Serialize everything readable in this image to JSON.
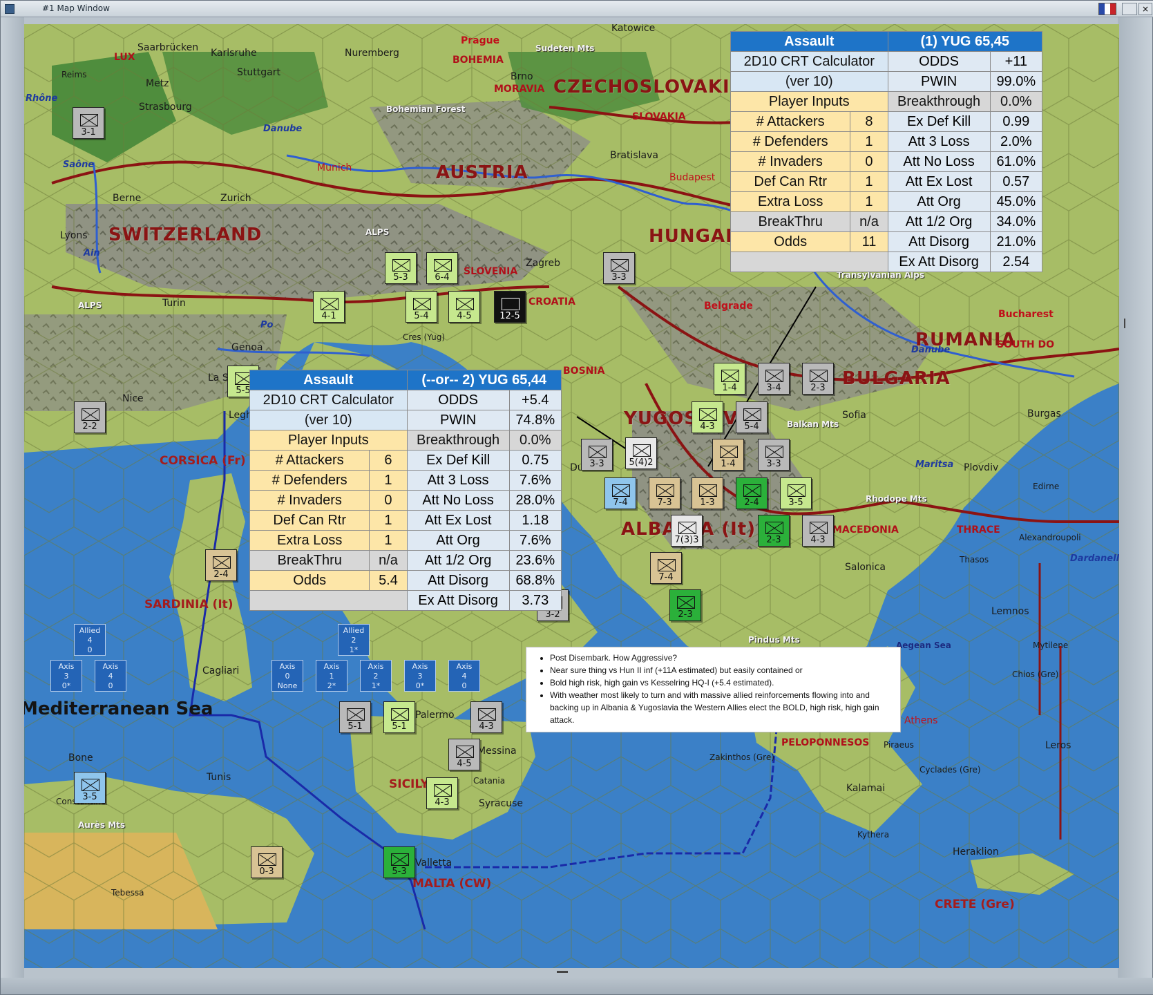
{
  "window": {
    "title": "#1 Map Window"
  },
  "calc1": {
    "header_left": "Assault",
    "header_right": "(1) YUG 65,45",
    "title_line1": "2D10 CRT Calculator",
    "title_line2": "(ver 10)",
    "inputs_label": "Player Inputs",
    "rows": [
      {
        "k": "# Attackers",
        "v": "8"
      },
      {
        "k": "# Defenders",
        "v": "1"
      },
      {
        "k": "# Invaders",
        "v": "0"
      },
      {
        "k": "Def Can Rtr",
        "v": "1"
      },
      {
        "k": "Extra Loss",
        "v": "1"
      },
      {
        "k": "BreakThru",
        "v": "n/a"
      },
      {
        "k": "Odds",
        "v": "11"
      }
    ],
    "results": [
      {
        "k": "ODDS",
        "v": "+11"
      },
      {
        "k": "PWIN",
        "v": "99.0%"
      },
      {
        "k": "Breakthrough",
        "v": "0.0%"
      },
      {
        "k": "Ex Def Kill",
        "v": "0.99"
      },
      {
        "k": "Att 3 Loss",
        "v": "2.0%"
      },
      {
        "k": "Att No Loss",
        "v": "61.0%"
      },
      {
        "k": "Att Ex Lost",
        "v": "0.57"
      },
      {
        "k": "Att Org",
        "v": "45.0%"
      },
      {
        "k": "Att 1/2 Org",
        "v": "34.0%"
      },
      {
        "k": "Att Disorg",
        "v": "21.0%"
      },
      {
        "k": "Ex Att Disorg",
        "v": "2.54"
      }
    ]
  },
  "calc2": {
    "header_left": "Assault",
    "header_right": "(--or-- 2) YUG 65,44",
    "title_line1": "2D10 CRT Calculator",
    "title_line2": "(ver 10)",
    "inputs_label": "Player Inputs",
    "rows": [
      {
        "k": "# Attackers",
        "v": "6"
      },
      {
        "k": "# Defenders",
        "v": "1"
      },
      {
        "k": "# Invaders",
        "v": "0"
      },
      {
        "k": "Def Can Rtr",
        "v": "1"
      },
      {
        "k": "Extra Loss",
        "v": "1"
      },
      {
        "k": "BreakThru",
        "v": "n/a"
      },
      {
        "k": "Odds",
        "v": "5.4"
      }
    ],
    "results": [
      {
        "k": "ODDS",
        "v": "+5.4"
      },
      {
        "k": "PWIN",
        "v": "74.8%"
      },
      {
        "k": "Breakthrough",
        "v": "0.0%"
      },
      {
        "k": "Ex Def Kill",
        "v": "0.75"
      },
      {
        "k": "Att 3 Loss",
        "v": "7.6%"
      },
      {
        "k": "Att No Loss",
        "v": "28.0%"
      },
      {
        "k": "Att Ex Lost",
        "v": "1.18"
      },
      {
        "k": "Att Org",
        "v": "7.6%"
      },
      {
        "k": "Att 1/2 Org",
        "v": "23.6%"
      },
      {
        "k": "Att Disorg",
        "v": "68.8%"
      },
      {
        "k": "Ex Att Disorg",
        "v": "3.73"
      }
    ]
  },
  "notes": [
    "Post Disembark.  How Aggressive?",
    "Near sure thing vs Hun II inf (+11A estimated) but easily contained or",
    "Bold high risk, high gain vs Kesselring HQ-I (+5.4 estimated).",
    "With weather most likely to turn and with massive allied reinforcements flowing into and backing up in Albania & Yugoslavia the Western Allies elect the BOLD, high risk, high gain attack."
  ],
  "map_labels": {
    "countries": [
      "SWITZERLAND",
      "AUSTRIA",
      "CZECHOSLOVAKIA",
      "HUNGARY",
      "YUGOSLAVIA",
      "BULGARIA",
      "RUMANIA",
      "ALBANIA (It)"
    ],
    "regions": [
      "CORSICA (Fr)",
      "SARDINIA (It)",
      "SICILY",
      "MALTA (CW)",
      "SLOVAKIA",
      "MORAVIA",
      "PELOPONNESOS",
      "CRETE (Gre)",
      "SOUTH DO",
      "THRACE",
      "MACEDONIA",
      "CROATIA",
      "SLOVENIA",
      "BOSNIA",
      "BOHEMIA",
      "LUX"
    ],
    "cities": [
      "Saarbrücken",
      "Karlsruhe",
      "Nuremberg",
      "Prague",
      "Katowice",
      "Reims",
      "Metz",
      "Stuttgart",
      "Brno",
      "Strasbourg",
      "Bohemian Forest",
      "Munich",
      "Bratislava",
      "Berne",
      "Zurich",
      "Budapest",
      "Lyons",
      "Zagreb",
      "Turin",
      "Belgrade",
      "Bucharest",
      "Nice",
      "Genoa",
      "La Spezia",
      "Cres (Yug)",
      "Sofia",
      "Burgas",
      "Plovdiv",
      "Edirne",
      "Salonica",
      "Alexandroupoli",
      "Thasos",
      "Lemnos",
      "Mytilene",
      "Chios (Gre)",
      "Athens",
      "Piraeus",
      "Leros",
      "Cyclades (Gre)",
      "Kalamai",
      "Kythera",
      "Heraklion",
      "Zakinthos (Gre)",
      "Pindus Mts",
      "Bone",
      "Tunis",
      "Constantine",
      "Aurès Mts",
      "Tebessa",
      "Catania",
      "Syracuse",
      "Messina",
      "Palermo",
      "Valletta",
      "Cagliari",
      "Legh",
      "Durazzo",
      "Sudeten Mts",
      "Transylvanian Alps",
      "Balkan Mts",
      "Rhodope Mts",
      "Aegean Sea",
      "Dardanelles"
    ],
    "rivers": [
      "Danube",
      "Saône",
      "Rhône",
      "Ain",
      "Po",
      "Maritsa",
      "Danube"
    ],
    "mountains": [
      "ALPS",
      "ALPS"
    ],
    "sea": "Mediterranean Sea"
  },
  "stack_boxes": [
    {
      "line1": "Allied",
      "line2": "4",
      "line3": "0"
    },
    {
      "line1": "Allied",
      "line2": "2",
      "line3": "1*"
    },
    {
      "line1": "Axis",
      "line2": "3",
      "line3": "0*"
    },
    {
      "line1": "Axis",
      "line2": "4",
      "line3": "0"
    },
    {
      "line1": "Axis",
      "line2": "0",
      "line3": "None"
    },
    {
      "line1": "Axis",
      "line2": "1",
      "line3": "2*"
    },
    {
      "line1": "Axis",
      "line2": "2",
      "line3": "1*"
    },
    {
      "line1": "Axis",
      "line2": "3",
      "line3": "0*"
    },
    {
      "line1": "Axis",
      "line2": "4",
      "line3": "0"
    }
  ],
  "counters": [
    {
      "name": "unit-3-1",
      "val": "3-1",
      "style": "c-grey"
    },
    {
      "name": "unit-5-3-slovenia",
      "val": "5-3",
      "style": "c-lgreen"
    },
    {
      "name": "unit-6-4-slovenia",
      "val": "6-4",
      "style": "c-lgreen"
    },
    {
      "name": "unit-4-1-venice",
      "val": "4-1",
      "style": "c-lgreen"
    },
    {
      "name": "unit-5-4",
      "val": "5-4",
      "style": "c-lgreen"
    },
    {
      "name": "unit-4-5",
      "val": "4-5",
      "style": "c-lgreen"
    },
    {
      "name": "unit-12-5",
      "val": "12-5",
      "style": "c-black"
    },
    {
      "name": "unit-3-3-hungary",
      "val": "3-3",
      "style": "c-grey"
    },
    {
      "name": "unit-2-2-nice",
      "val": "2-2",
      "style": "c-grey"
    },
    {
      "name": "unit-5-5",
      "val": "5-5",
      "style": "c-lgreen"
    },
    {
      "name": "unit-2-4-sardinia",
      "val": "2-4",
      "style": "c-tan"
    },
    {
      "name": "unit-3-3-dubrovnik",
      "val": "3-3",
      "style": "c-grey"
    },
    {
      "name": "unit-5-4-2",
      "val": "5(4)2",
      "style": "c-white"
    },
    {
      "name": "unit-1-4-a",
      "val": "1-4",
      "style": "c-tan"
    },
    {
      "name": "unit-3-3-b",
      "val": "3-3",
      "style": "c-grey"
    },
    {
      "name": "unit-4-3-yug",
      "val": "4-3",
      "style": "c-lgreen"
    },
    {
      "name": "unit-5-4-yug",
      "val": "5-4",
      "style": "c-grey"
    },
    {
      "name": "unit-1-4-b",
      "val": "1-4",
      "style": "c-lgreen"
    },
    {
      "name": "unit-3-4",
      "val": "3-4",
      "style": "c-grey"
    },
    {
      "name": "unit-2-3-bul",
      "val": "2-3",
      "style": "c-grey"
    },
    {
      "name": "unit-7-4-blue",
      "val": "7-4",
      "style": "c-blue"
    },
    {
      "name": "unit-7-3",
      "val": "7-3",
      "style": "c-tan"
    },
    {
      "name": "unit-1-3",
      "val": "1-3",
      "style": "c-tan"
    },
    {
      "name": "unit-2-4-green",
      "val": "2-4",
      "style": "c-green"
    },
    {
      "name": "unit-3-5",
      "val": "3-5",
      "style": "c-lgreen"
    },
    {
      "name": "unit-7-3-3",
      "val": "7(3)3",
      "style": "c-white"
    },
    {
      "name": "unit-2-3-green",
      "val": "2-3",
      "style": "c-green"
    },
    {
      "name": "unit-4-3-grey",
      "val": "4-3",
      "style": "c-grey"
    },
    {
      "name": "unit-7-4-tan",
      "val": "7-4",
      "style": "c-tan"
    },
    {
      "name": "unit-2-3-green-b",
      "val": "2-3",
      "style": "c-green"
    },
    {
      "name": "unit-5-1",
      "val": "5-1",
      "style": "c-grey"
    },
    {
      "name": "unit-5-1-b",
      "val": "5-1",
      "style": "c-lgreen"
    },
    {
      "name": "unit-4-3-sicily",
      "val": "4-3",
      "style": "c-grey"
    },
    {
      "name": "unit-4-5-messina",
      "val": "4-5",
      "style": "c-grey"
    },
    {
      "name": "unit-4-3-sicily-b",
      "val": "4-3",
      "style": "c-lgreen"
    },
    {
      "name": "unit-3-5-tunis",
      "val": "3-5",
      "style": "c-blue"
    },
    {
      "name": "unit-0-3",
      "val": "0-3",
      "style": "c-tan"
    },
    {
      "name": "unit-5-3-malta",
      "val": "5-3",
      "style": "c-green"
    },
    {
      "name": "unit-3-2",
      "val": "3-2",
      "style": "c-grey"
    }
  ]
}
